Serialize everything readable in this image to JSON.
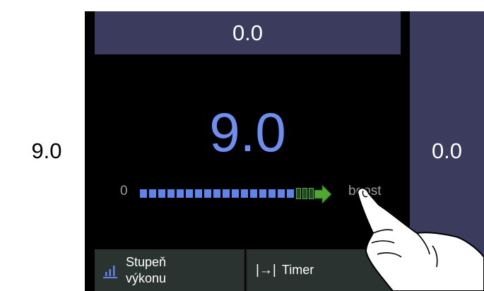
{
  "zones": {
    "left_value": "9.0",
    "top_value": "0.0",
    "right_value": "0.0"
  },
  "main": {
    "power_level": "9.0"
  },
  "scale": {
    "min_label": "0",
    "max_label": "boost"
  },
  "buttons": {
    "level_line1": "Stupeň",
    "level_line2": "výkonu",
    "timer_label": "Timer"
  },
  "colors": {
    "accent_blue": "#5f84ec",
    "boost_green": "#56a83a",
    "zone_purple": "#3b3b5e"
  },
  "icons": {
    "level": "bar-chart-icon",
    "timer": "arrow-to-line-icon",
    "boost": "arrow-right-icon"
  }
}
